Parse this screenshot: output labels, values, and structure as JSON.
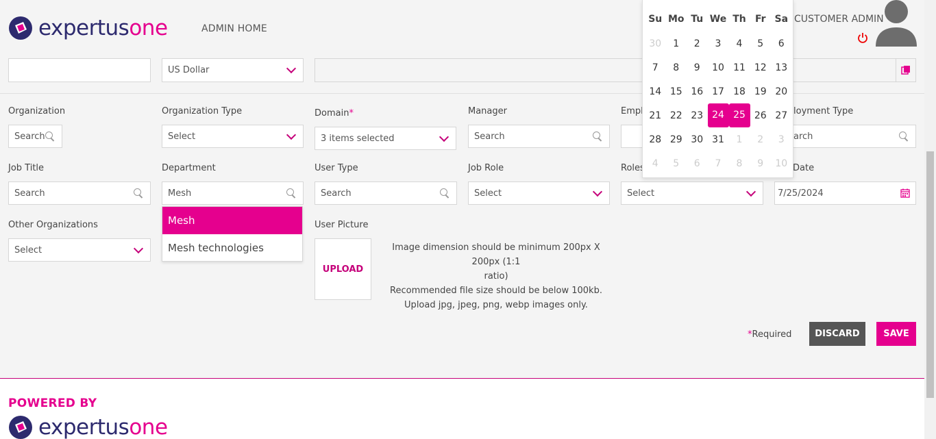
{
  "header": {
    "logo_text_a": "expertus",
    "logo_text_b": "one",
    "nav_admin_home": "ADMIN HOME",
    "user_role": "CUSTOMER ADMIN"
  },
  "top_row": {
    "field1_value": "",
    "currency_value": "US Dollar",
    "field3_value": ""
  },
  "labels": {
    "organization": "Organization",
    "organization_type": "Organization Type",
    "domain": "Domain",
    "domain_required": "*",
    "manager": "Manager",
    "employee_number": "Emplo",
    "employment_type": "loyment Type",
    "job_title": "Job Title",
    "department": "Department",
    "user_type": "User Type",
    "job_role": "Job Role",
    "roles": "Roles",
    "date": "Date",
    "other_organizations": "Other Organizations",
    "user_picture": "User Picture"
  },
  "fields": {
    "organization_placeholder": "Search",
    "organization_type_value": "Select",
    "domain_value": "3 items selected",
    "manager_placeholder": "Search",
    "employment_type_placeholder": "arch",
    "job_title_placeholder": "Search",
    "department_value": "Mesh",
    "user_type_placeholder": "Search",
    "job_role_value": "Select",
    "roles_value": "Select",
    "date_value": "7/25/2024",
    "other_organizations_value": "Select"
  },
  "department_dropdown": {
    "options": [
      "Mesh",
      "Mesh technologies"
    ],
    "selected_index": 0
  },
  "upload": {
    "button_label": "UPLOAD",
    "hint_line1": "Image dimension should be minimum 200px X 200px (1:1",
    "hint_line2": "ratio)",
    "hint_line3": "Recommended file size should be below 100kb.",
    "hint_line4": "Upload jpg, jpeg, png, webp images only."
  },
  "actions": {
    "required_star": "*",
    "required_text": "Required",
    "discard_label": "DISCARD",
    "save_label": "SAVE"
  },
  "calendar": {
    "weekdays": [
      "Su",
      "Mo",
      "Tu",
      "We",
      "Th",
      "Fr",
      "Sa"
    ],
    "weeks": [
      [
        "30",
        "1",
        "2",
        "3",
        "4",
        "5",
        "6"
      ],
      [
        "7",
        "8",
        "9",
        "10",
        "11",
        "12",
        "13"
      ],
      [
        "14",
        "15",
        "16",
        "17",
        "18",
        "19",
        "20"
      ],
      [
        "21",
        "22",
        "23",
        "24",
        "25",
        "26",
        "27"
      ],
      [
        "28",
        "29",
        "30",
        "31",
        "1",
        "2",
        "3"
      ],
      [
        "4",
        "5",
        "6",
        "7",
        "8",
        "9",
        "10"
      ]
    ],
    "selected": [
      "24",
      "25"
    ]
  },
  "footer": {
    "powered_by": "POWERED BY",
    "logo_text_a": "expertus",
    "logo_text_b": "one"
  },
  "colors": {
    "brand_pink": "#e5008e",
    "brand_navy": "#2d2a6e",
    "discard_bg": "#555555"
  }
}
